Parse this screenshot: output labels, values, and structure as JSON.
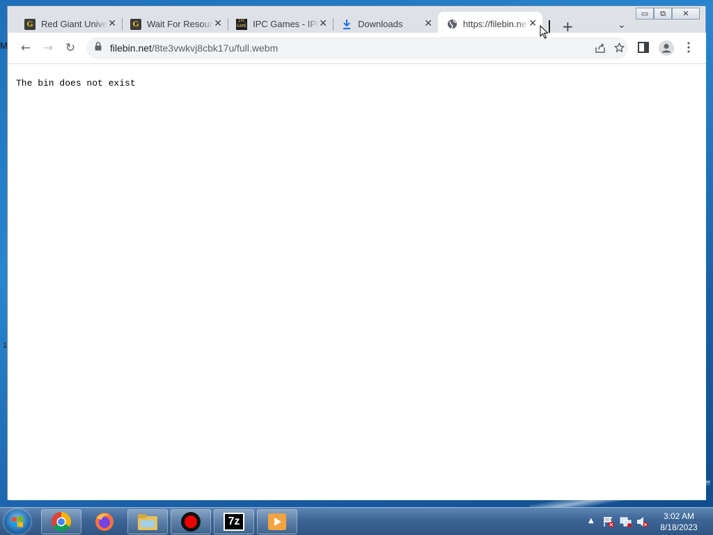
{
  "desktop": {
    "edge_letter": "M",
    "edge_digit": "1"
  },
  "window_controls": {
    "minimize": "▭",
    "restore": "⧉",
    "close": "✕"
  },
  "tabs": [
    {
      "label": "Red Giant Unive",
      "icon": "g-favicon",
      "close": "✕"
    },
    {
      "label": "Wait For Resour",
      "icon": "g-favicon",
      "close": "✕"
    },
    {
      "label": "IPC Games - IPC",
      "icon": "ipc-favicon",
      "close": "✕"
    },
    {
      "label": "Downloads",
      "icon": "download-icon",
      "close": "✕"
    },
    {
      "label": "https://filebin.ne",
      "icon": "globe-icon",
      "close": "✕",
      "active": true
    }
  ],
  "toolbar": {
    "new_tab": "+",
    "tab_search": "⌄",
    "back": "←",
    "forward": "→",
    "reload": "↻",
    "url_host": "filebin.net",
    "url_path": "/8te3vwkvj8cbk17u/full.webm"
  },
  "page": {
    "message": "The bin does not exist"
  },
  "taskbar": {
    "apps": [
      "chrome-icon",
      "firefox-icon",
      "file-explorer-icon",
      "recorder-icon",
      "7zip-icon",
      "media-player-icon"
    ],
    "sevenzip_label": "7z",
    "tray_arrow": "▲",
    "time": "3:02 AM",
    "date": "8/18/2023"
  }
}
